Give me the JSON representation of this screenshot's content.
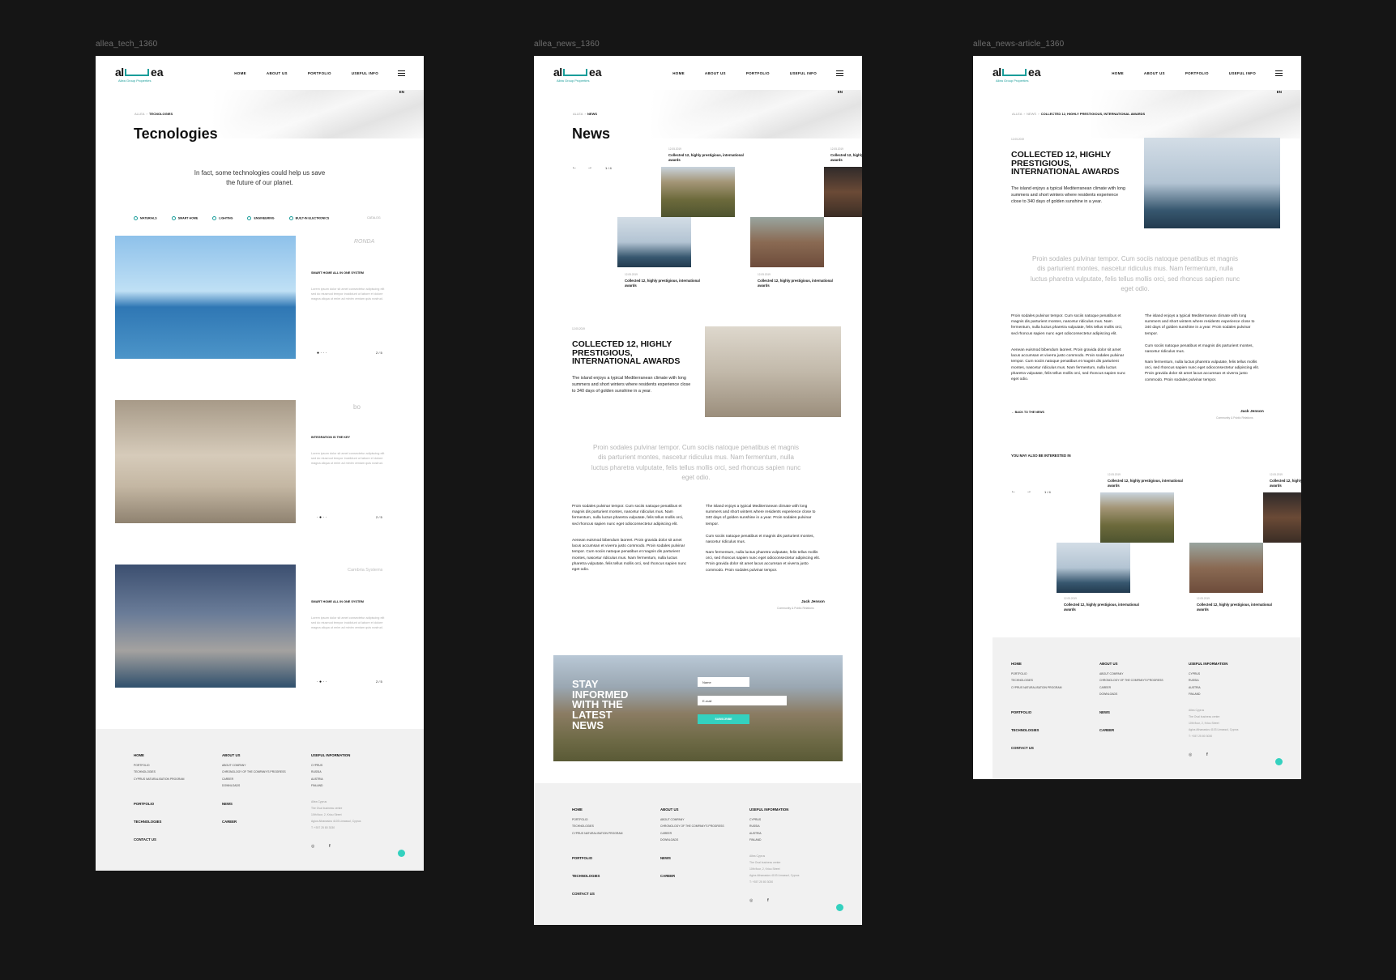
{
  "frames": {
    "tech": "allea_tech_1360",
    "news": "allea_news_1360",
    "article": "allea_news-article_1360"
  },
  "brand": {
    "logo_prefix": "al",
    "logo_suffix": "ea",
    "tagline": "Allea Group Properties",
    "accent": "#1a9d9a",
    "chat_color": "#34d1bf"
  },
  "nav": {
    "items": [
      "HOME",
      "ABOUT US",
      "PORTFOLIO",
      "USEFUL INFO"
    ],
    "lang": "EN",
    "burger_icon": "hamburger-icon"
  },
  "tech": {
    "crumb_root": "ALLEA",
    "crumb_current": "TECNOLOGIES",
    "title": "Tecnologies",
    "intro_line1": "In fact, some technologies could help us save",
    "intro_line2": "the future of our planet.",
    "filters": [
      "MATERIALS",
      "SMART HOME",
      "LIGHTING",
      "ENGINEERING",
      "BUILT-IN ELECTRONICS"
    ],
    "catalog": "CATALOG",
    "items": [
      {
        "brand": "RONDA",
        "heading": "SMART HOME ALL IN ONE SYSTEM",
        "text": "Lorem ipsum dolor sit amet consectetur adipiscing elit sed do eiusmod tempor incididunt ut labore et dolore magna aliqua ut enim ad minim veniam quis nostrud.",
        "page": "2 / 5"
      },
      {
        "brand": "bo",
        "heading": "INTEGRATION IS THE KEY",
        "text": "Lorem ipsum dolor sit amet consectetur adipiscing elit sed do eiusmod tempor incididunt ut labore et dolore magna aliqua ut enim ad minim veniam quis nostrud.",
        "page": "2 / 5"
      },
      {
        "brand": "Cambria Systems",
        "heading": "SMART HOME ALL IN ONE SYSTEM",
        "text": "Lorem ipsum dolor sit amet consectetur adipiscing elit sed do eiusmod tempor incididunt ut labore et dolore magna aliqua ut enim ad minim veniam quis nostrud.",
        "page": "2 / 5"
      }
    ]
  },
  "news": {
    "crumb_root": "ALLEA",
    "crumb_current": "NEWS",
    "title": "News",
    "slider_count": "1 / 4",
    "card_date": "12.05.2019",
    "card_title": "Collected 12, highly prestigious, international awards",
    "featured_date": "12.05.2019",
    "featured_title": "COLLECTED 12, HIGHLY PRESTIGIOUS, INTERNATIONAL AWARDS",
    "featured_text": "The island enjoys a typical Mediterranean climate with long summers and short winters where residents experience close to 340 days of golden sunshine in a year.",
    "quote": "Proin sodales pulvinar tempor. Cum sociis natoque penatibus et magnis dis parturient montes, nascetur ridiculus mus. Nam fermentum, nulla luctus pharetra vulputate, felis tellus mollis orci, sed rhoncus sapien nunc eget odio.",
    "col1_p1": "Proin sodales pulvinar tempor. Cum sociis natoque penatibus et magnis dis parturient montes, nascetur ridiculus mus. Nam fermentum, nulla luctus pharetra vulputate, felis tellus mollis orci, sed rhoncus sapien nunc eget odioconsectetur adipiscing elit.",
    "col1_p2": "Aenean euismod bibendum laoreet. Proin gravida dolor sit amet lacus accumsan et viverra justo commodo. Proin sodales pulvinar tempor. Cum sociis natoque penatibus et magnis dis parturient montes, nascetur ridiculus mus. Nam fermentum, nulla luctus pharetra vulputate, felis tellus mollis orci, sed rhoncus sapien nunc eget odio.",
    "col2_p1": "The island enjoys a typical Mediterranean climate with long summers and short winters where residents experience close to 340 days of golden sunshine in a year. Proin sodales pulvinar tempor.",
    "col2_p2": "Cum sociis natoque penatibus et magnis dis parturient montes, nascetur ridiculus mus.",
    "col2_p3": "Nam fermentum, nulla luctus pharetra vulputate, felis tellus mollis orci, sed rhoncus sapien nunc eget odioconsectetur adipiscing elit. Proin gravida dolor sit amet lacus accumsan et viverra justo commodo. Proin sodales pulvinar tempor.",
    "author": "Jack Jenson",
    "author_role": "Community & Public Relations",
    "newsletter_title": "STAY INFORMED WITH THE LATEST NEWS",
    "name_placeholder": "Name",
    "email_placeholder": "E-mail",
    "subscribe": "SUBSCRIBE"
  },
  "article": {
    "crumb_root": "ALLEA",
    "crumb_mid": "NEWS",
    "crumb_current": "COLLECTED 12, HIGHLY PRESTIGIOUS, INTERNATIONAL AWARDS",
    "date": "12.05.2019",
    "title": "COLLECTED 12, HIGHLY PRESTIGIOUS, INTERNATIONAL AWARDS",
    "lead": "The island enjoys a typical Mediterranean climate with long summers and short winters where residents experience close to 340 days of golden sunshine in a year.",
    "back": "BACK TO THE NEWS",
    "related": "YOU MAY ALSO BE INTERESTED IN"
  },
  "footer": {
    "home": "HOME",
    "home_links": [
      "PORTFOLIO",
      "TECHNOLOGIES",
      "CYPRUS NATURALISATION PROGRAM"
    ],
    "about": "ABOUT US",
    "about_links": [
      "ABOUT COMPANY",
      "CHRONOLOGY OF THE COMPANY'S PROGRESS",
      "CAREER",
      "DOWNLOADS"
    ],
    "useful": "USEFUL INFORMATION",
    "useful_links": [
      "CYPRUS",
      "RUSSIA",
      "AUSTRIA",
      "FINLAND"
    ],
    "portfolio": "PORTFOLIO",
    "news": "NEWS",
    "technologies": "TECHNOLOGIES",
    "career": "CAREER",
    "contact": "CONTACT US",
    "address": [
      "Allea Cyprus",
      "The Oval business centre",
      "10th floor, 2, Kriou Street",
      "Agios Athanasios 4103 Limassol, Cyprus",
      "T: +357 25 80 3030"
    ],
    "social": [
      "instagram-icon",
      "facebook-icon"
    ]
  }
}
